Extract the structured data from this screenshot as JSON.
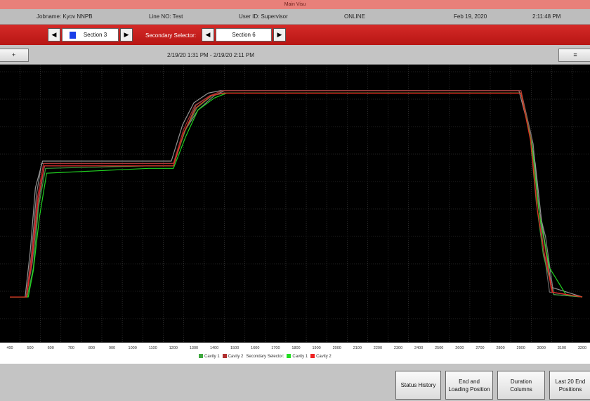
{
  "window": {
    "title": "Main Visu"
  },
  "info_bar": {
    "jobname": "Jobname: Kyov NNPB",
    "line_no": "Line NO: Test",
    "user_id": "User ID: Supervisor",
    "status": "ONLINE",
    "date": "Feb 19, 2020",
    "time": "2:11:48 PM"
  },
  "selector": {
    "primary_value": "Section 3",
    "primary_swatch_color": "#1a3ee8",
    "secondary_label": "Secondary Selector:",
    "secondary_value": "Section 6",
    "prev_icon": "triangle-left-icon",
    "next_icon": "triangle-right-icon"
  },
  "toolbar": {
    "left_button_icon": "plus-icon",
    "left_button_label": "+",
    "right_button_icon": "settings-icon",
    "right_button_label": "≡",
    "time_range": "2/19/20 1:31 PM - 2/19/20 2:11 PM"
  },
  "chart_data": {
    "type": "line",
    "x_ticks": [
      400,
      500,
      600,
      700,
      800,
      900,
      1000,
      1100,
      1200,
      1300,
      1400,
      1500,
      1600,
      1700,
      1800,
      1900,
      2000,
      2100,
      2200,
      2300,
      2400,
      2500,
      2600,
      2700,
      2800,
      2900,
      3000,
      3100,
      3200
    ],
    "xlim": [
      400,
      3200
    ],
    "ylim": [
      0,
      100
    ],
    "grid": true,
    "legend_position": "bottom-center",
    "legend": [
      {
        "name": "Cavity 1",
        "color": "#3fa83f"
      },
      {
        "name": "Cavity 2",
        "color": "#b03030"
      },
      {
        "name": "Secondary Selector:",
        "color": ""
      },
      {
        "name": "Cavity 1",
        "color": "#22dd22"
      },
      {
        "name": "Cavity 2",
        "color": "#ee2222"
      }
    ],
    "series": [
      {
        "color": "#8a8a8a",
        "x": [
          400,
          480,
          505,
          530,
          555,
          1080,
          1200,
          1260,
          1320,
          1400,
          1450,
          1520,
          2900,
          2960,
          2990,
          3020,
          3060,
          3200
        ],
        "y": [
          13,
          13,
          30,
          55,
          68,
          68,
          68,
          82,
          90,
          96,
          98,
          98,
          98,
          76,
          48,
          38,
          14,
          13
        ]
      },
      {
        "color": "#707070",
        "x": [
          400,
          480,
          510,
          540,
          570,
          1080,
          1200,
          1250,
          1310,
          1380,
          1440,
          1510,
          2900,
          2950,
          2980,
          3010,
          3040,
          3200
        ],
        "y": [
          13,
          13,
          27,
          52,
          67,
          67,
          67,
          80,
          92,
          96,
          97,
          97,
          97,
          80,
          55,
          33,
          15,
          13
        ]
      },
      {
        "color": "#9a9a9a",
        "x": [
          400,
          475,
          500,
          525,
          560,
          1070,
          1190,
          1245,
          1300,
          1370,
          1430,
          1500,
          2890,
          2940,
          2970,
          3000,
          3050,
          3200
        ],
        "y": [
          13,
          13,
          32,
          58,
          69,
          69,
          69,
          84,
          93,
          97,
          98,
          98,
          98,
          82,
          68,
          45,
          17,
          13
        ]
      },
      {
        "color": "#3fa83f",
        "x": [
          400,
          485,
          515,
          540,
          575,
          1080,
          1200,
          1255,
          1315,
          1390,
          1450,
          1520,
          2900,
          2945,
          2975,
          3010,
          3060,
          3200
        ],
        "y": [
          13,
          13,
          25,
          50,
          66,
          67,
          67,
          81,
          91,
          96,
          97,
          97,
          97,
          79,
          52,
          30,
          14,
          13
        ]
      },
      {
        "color": "#b03030",
        "x": [
          400,
          480,
          505,
          535,
          565,
          1080,
          1200,
          1250,
          1305,
          1380,
          1440,
          1510,
          2900,
          2950,
          2985,
          3015,
          3050,
          3200
        ],
        "y": [
          13,
          13,
          29,
          54,
          68,
          68,
          68,
          82,
          92,
          96,
          98,
          98,
          98,
          78,
          50,
          35,
          15,
          13
        ]
      },
      {
        "color": "#22dd22",
        "x": [
          400,
          490,
          515,
          545,
          580,
          1080,
          1200,
          1260,
          1320,
          1400,
          1460,
          1530,
          2900,
          2955,
          2990,
          3040,
          3120,
          3200
        ],
        "y": [
          13,
          13,
          24,
          46,
          64,
          66,
          66,
          79,
          90,
          95,
          97,
          97,
          97,
          75,
          47,
          25,
          14,
          13
        ]
      },
      {
        "color": "#ee2222",
        "x": [
          400,
          482,
          508,
          538,
          568,
          1080,
          1200,
          1252,
          1310,
          1385,
          1445,
          1515,
          2900,
          2948,
          2980,
          3012,
          3055,
          3200
        ],
        "y": [
          13,
          13,
          28,
          53,
          67,
          67,
          67,
          81,
          91,
          96,
          97,
          97,
          97,
          77,
          49,
          32,
          15,
          13
        ]
      }
    ]
  },
  "bottom_buttons": [
    {
      "label": "Status History"
    },
    {
      "label": "End and Loading Position"
    },
    {
      "label": "Duration Columns"
    },
    {
      "label": "Last 20 End Positions"
    }
  ]
}
